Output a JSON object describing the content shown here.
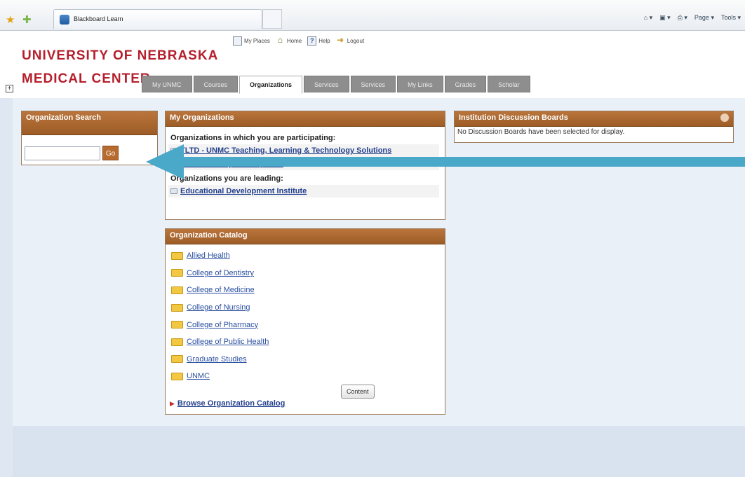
{
  "browser": {
    "tab_title": "Blackboard Learn",
    "commands": [
      "Page ▾",
      "Tools ▾"
    ]
  },
  "header": {
    "logo_line1": "UNIVERSITY OF NEBRASKA",
    "logo_line2": "MEDICAL CENTER",
    "top_links": {
      "my_places": "My Places",
      "home": "Home",
      "help": "Help",
      "logout": "Logout"
    },
    "tabs": [
      "My UNMC",
      "Courses",
      "Organizations",
      "Services",
      "Services",
      "My Links",
      "Grades",
      "Scholar"
    ],
    "active_tab": "Organizations"
  },
  "org_search": {
    "title": "Organization Search",
    "input_value": "",
    "go_label": "Go"
  },
  "my_orgs": {
    "title": "My Organizations",
    "participating_label": "Organizations in which you are participating:",
    "participating": [
      "TLTD - UNMC Teaching, Learning & Technology Solutions",
      "UNMC Faculty Development"
    ],
    "leading_label": "Organizations you are leading:",
    "leading": [
      "Educational Development Institute"
    ]
  },
  "catalog": {
    "title": "Organization Catalog",
    "items": [
      "Allied Health",
      "College of Dentistry",
      "College of Medicine",
      "College of Nursing",
      "College of Pharmacy",
      "College of Public Health",
      "Graduate Studies",
      "UNMC"
    ],
    "content_button": "Content",
    "browse_label": "Browse Organization Catalog"
  },
  "discussion": {
    "title": "Institution Discussion Boards",
    "message": "No Discussion Boards have been selected for display."
  },
  "colors": {
    "module_header": "#a9652d",
    "brand_red": "#b51e2b",
    "arrow": "#4aa8c9"
  }
}
